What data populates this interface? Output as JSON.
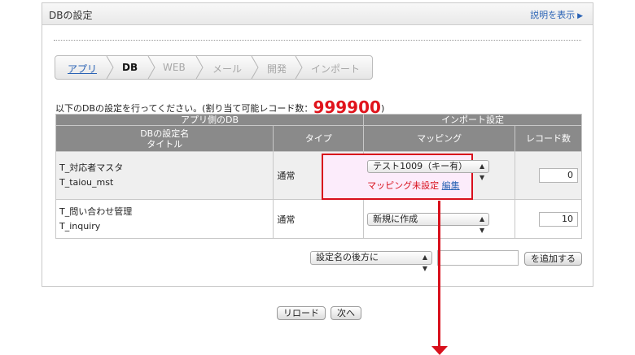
{
  "panel": {
    "title": "DBの設定",
    "help": "説明を表示",
    "help_icon": "triangle-right"
  },
  "breadcrumb": [
    "アプリ",
    "DB",
    "WEB",
    "メール",
    "開発",
    "インポート"
  ],
  "description": {
    "before": "以下のDBの設定を行ってください。(割り当て可能レコード数：",
    "count": "999900",
    "after": ")"
  },
  "table": {
    "group_left": "アプリ側のDB",
    "group_right": "インポート設定",
    "col_name_1": "DBの設定名",
    "col_name_2": "タイトル",
    "col_type": "タイプ",
    "col_mapping": "マッピング",
    "col_records": "レコード数",
    "rows": [
      {
        "name": "T_対応者マスタ",
        "title": "T_taiou_mst",
        "type": "通常",
        "mapping": "テスト1009（キー有）",
        "status": "マッピング未設定",
        "edit": "編集",
        "records": "0"
      },
      {
        "name": "T_問い合わせ管理",
        "title": "T_inquiry",
        "type": "通常",
        "mapping": "新規に作成",
        "records": "10"
      }
    ]
  },
  "add": {
    "position": "設定名の後方に",
    "name_value": "",
    "button": "を追加する"
  },
  "footer": {
    "reload": "リロード",
    "next": "次へ"
  },
  "colors": {
    "accent_red": "#d8101c",
    "link_blue": "#2a63b5",
    "header_gray": "#8a8a8a",
    "highlight_pink": "#fcecfb"
  }
}
